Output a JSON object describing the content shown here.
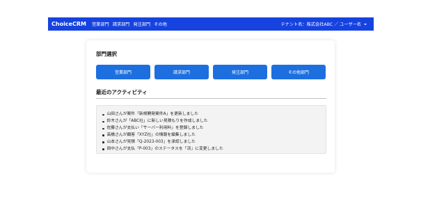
{
  "navbar": {
    "brand": "ChoiceCRM",
    "links": [
      {
        "label": "営業部門"
      },
      {
        "label": "請求部門"
      },
      {
        "label": "発注部門"
      },
      {
        "label": "その他"
      }
    ],
    "tenant_label": "テナント名：株式会社ABC ／ ユーザー名",
    "background": "#1643e0"
  },
  "departments": {
    "title": "部門選択",
    "buttons": [
      {
        "label": "営業部門"
      },
      {
        "label": "請求部門"
      },
      {
        "label": "発注部門"
      },
      {
        "label": "その他部門"
      }
    ],
    "button_color": "#1d6fe0"
  },
  "activity": {
    "title": "最近のアクティビティ",
    "items": [
      {
        "text": "山田さんが案件「新規開発案件A」を更新しました"
      },
      {
        "text": "鈴木さんが「ABC社」に新しい見積もりを作成しました"
      },
      {
        "text": "佐藤さんが支払い「サーバー利用料」を登録しました"
      },
      {
        "text": "高橋さんが顧客「XYZ社」の情報を編集しました"
      },
      {
        "text": "山本さんが見積「Q-2023-003」を承認しました"
      },
      {
        "text": "田中さんが支払「P-003」のステータスを「済」に変更しました"
      }
    ]
  }
}
